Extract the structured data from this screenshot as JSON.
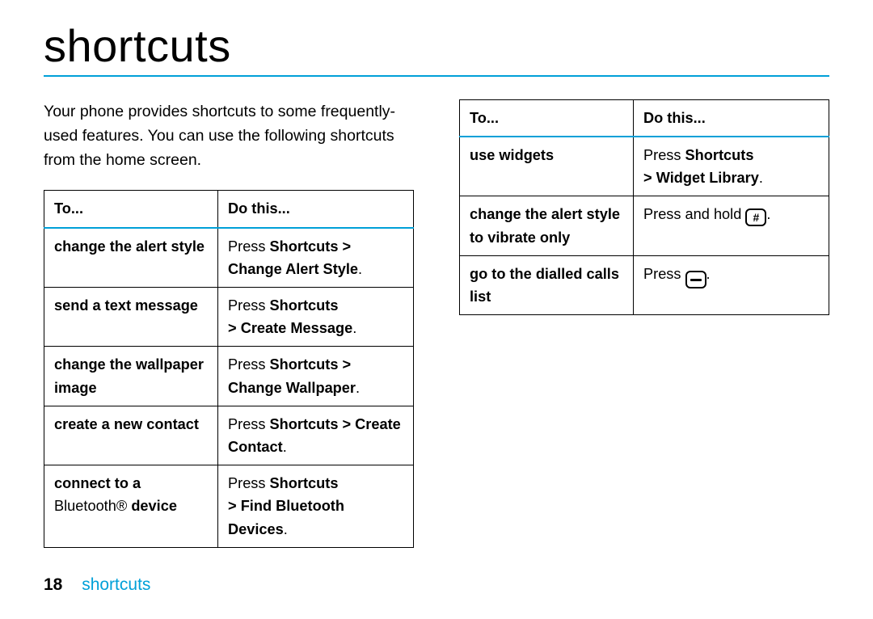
{
  "page": {
    "title": "shortcuts",
    "intro": "Your phone provides shortcuts to some frequently-used features. You can use the following shortcuts from the home screen.",
    "header_to": "To...",
    "header_do": "Do this...",
    "page_number": "18",
    "section_name": "shortcuts"
  },
  "table1": {
    "rows": {
      "r0": {
        "to": "change the alert style",
        "do_prefix": "Press ",
        "do_menu": "Shortcuts > Change Alert Style",
        "do_suffix": "."
      },
      "r1": {
        "to": "send a text message",
        "do_prefix": "Press ",
        "do_menu1": "Shortcuts",
        "do_sep": " > ",
        "do_menu2": "Create Message",
        "do_suffix": "."
      },
      "r2": {
        "to": "change the wallpaper image",
        "do_prefix": "Press ",
        "do_menu": "Shortcuts > Change Wallpaper",
        "do_suffix": "."
      },
      "r3": {
        "to_pre": "create a new contact",
        "do_prefix": "Press ",
        "do_menu": "Shortcuts > Create Contact",
        "do_suffix": "."
      },
      "r4": {
        "to_bold1": "connect to a",
        "to_norm": " Bluetooth® ",
        "to_bold2": "device",
        "do_prefix": "Press ",
        "do_menu1": "Shortcuts",
        "do_sep": " > ",
        "do_menu2": "Find Bluetooth Devices",
        "do_suffix": "."
      }
    }
  },
  "table2": {
    "rows": {
      "r0": {
        "to": "use widgets",
        "do_prefix": "Press ",
        "do_menu1": "Shortcuts",
        "do_sep": " > ",
        "do_menu2": "Widget Library",
        "do_suffix": "."
      },
      "r1": {
        "to": "change the alert style to vibrate only",
        "do_prefix": "Press and hold ",
        "key_label": "#",
        "do_suffix": "."
      },
      "r2": {
        "to": "go to the dialled calls list",
        "do_prefix": "Press ",
        "do_suffix": "."
      }
    }
  }
}
